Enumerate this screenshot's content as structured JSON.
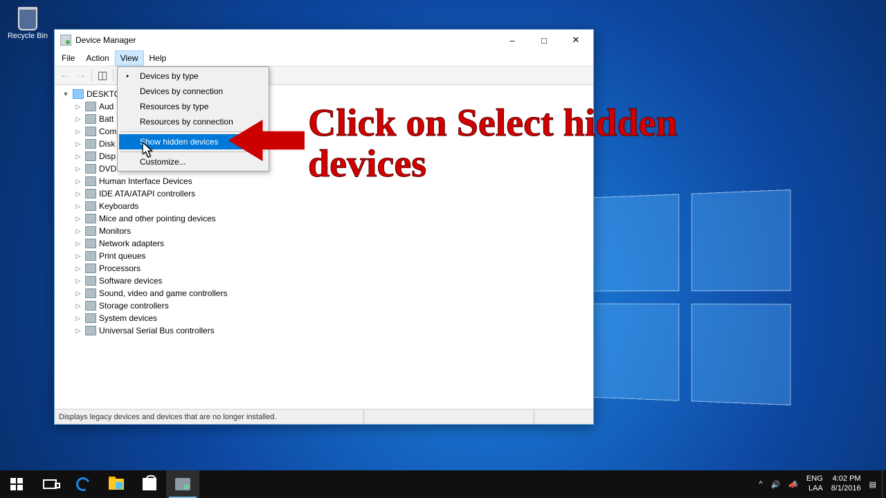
{
  "desktop": {
    "recycle_bin": "Recycle Bin"
  },
  "window": {
    "title": "Device Manager",
    "menus": {
      "file": "File",
      "action": "Action",
      "view": "View",
      "help": "Help"
    },
    "view_menu": {
      "devices_by_type": "Devices by type",
      "devices_by_connection": "Devices by connection",
      "resources_by_type": "Resources by type",
      "resources_by_connection": "Resources by connection",
      "show_hidden_devices": "Show hidden devices",
      "customize": "Customize..."
    },
    "root": "DESKTO",
    "nodes": [
      "Aud",
      "Batt",
      "Com",
      "Disk",
      "Disp",
      "DVD",
      "Human Interface Devices",
      "IDE ATA/ATAPI controllers",
      "Keyboards",
      "Mice and other pointing devices",
      "Monitors",
      "Network adapters",
      "Print queues",
      "Processors",
      "Software devices",
      "Sound, video and game controllers",
      "Storage controllers",
      "System devices",
      "Universal Serial Bus controllers"
    ],
    "status": "Displays legacy devices and devices that are no longer installed."
  },
  "annotation": {
    "text": "Click on Select hidden devices"
  },
  "taskbar": {
    "lang1": "ENG",
    "lang2": "LAA",
    "time": "4:02 PM",
    "date": "8/1/2016"
  }
}
